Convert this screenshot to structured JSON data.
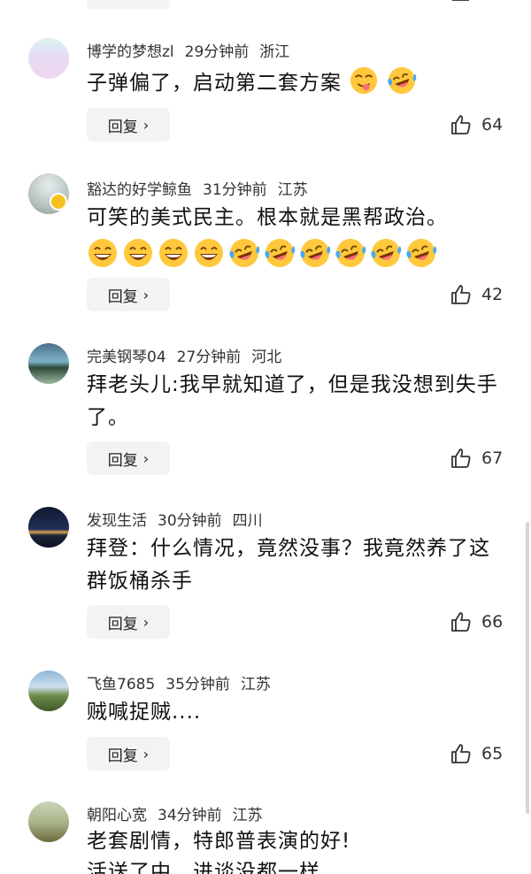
{
  "reply_label": "回复",
  "reply_arrow": "›",
  "comments": [
    {
      "user": "博学的梦想zl",
      "time": "29分钟前",
      "location": "浙江",
      "text": "子弹偏了，启动第二套方案",
      "likes": "64"
    },
    {
      "user": "豁达的好学鲸鱼",
      "time": "31分钟前",
      "location": "江苏",
      "text": "可笑的美式民主。根本就是黑帮政治。",
      "likes": "42"
    },
    {
      "user": "完美钢琴04",
      "time": "27分钟前",
      "location": "河北",
      "text": "拜老头儿:我早就知道了，但是我没想到失手了。",
      "likes": "67"
    },
    {
      "user": "发现生活",
      "time": "30分钟前",
      "location": "四川",
      "text": "拜登：什么情况，竟然没事？我竟然养了这群饭桶杀手",
      "likes": "66"
    },
    {
      "user": "飞鱼7685",
      "time": "35分钟前",
      "location": "江苏",
      "text": "贼喊捉贼....",
      "likes": "65"
    },
    {
      "user": "朝阳心宽",
      "time": "34分钟前",
      "location": "江苏",
      "text": "老套剧情，特郎普表演的好!"
    }
  ],
  "truncated_line": "活送了中，进谈没都一样",
  "colors": {
    "reply_bg": "#f3f3f3",
    "emoji_yellow": "#ffc83d",
    "tear_blue": "#4aa8f0"
  }
}
